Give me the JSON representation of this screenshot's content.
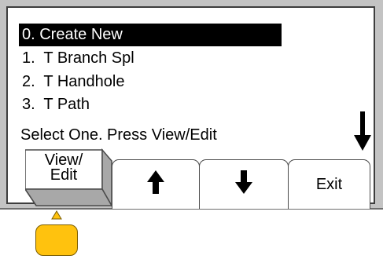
{
  "menu": {
    "items": [
      {
        "label": "0. Create New",
        "selected": true
      },
      {
        "label": "1.  T Branch Spl",
        "selected": false
      },
      {
        "label": "2.  T Handhole",
        "selected": false
      },
      {
        "label": "3.  T Path",
        "selected": false
      }
    ],
    "prompt": "Select One.  Press View/Edit"
  },
  "softkeys": {
    "view_edit_line1": "View/",
    "view_edit_line2": "Edit",
    "up_icon": "up-arrow-icon",
    "down_icon": "down-arrow-icon",
    "exit": "Exit"
  },
  "indicators": {
    "scroll_icon": "scroll-down-arrow-icon",
    "pointer_icon": "triangle-up-icon",
    "button_color": "#ffc20e",
    "pointer_color": "#ffc20e"
  }
}
